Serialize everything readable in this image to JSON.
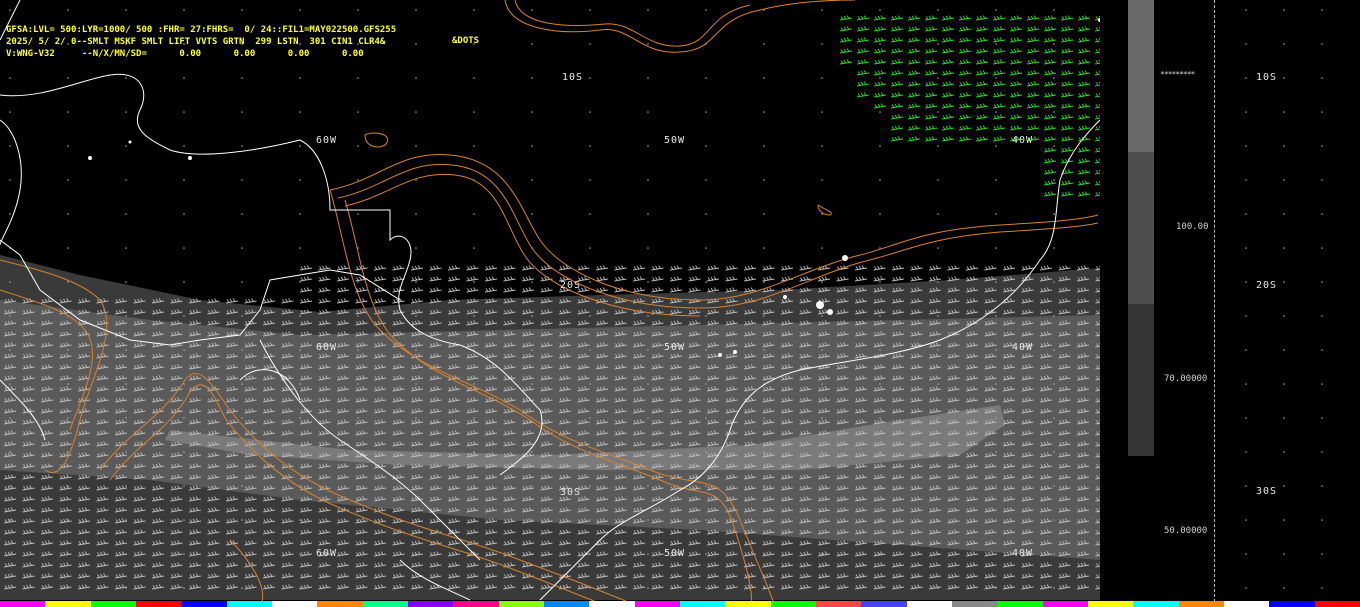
{
  "header": {
    "line1": "GFSA:LVL= 500:LYR=1000/ 500 :FHR= 27:FHRS=  0/ 24::FIL1=MAY022500.GFS255",
    "line2": "2025/ 5/ 2/ 0--SMLT MSKF SMLT LIFT VVTS GRTN  299 LSTN  301 CIN1 CLR4&",
    "line3": "V:WNG-V32     --N/X/MN/SD=      0.00      0.00      0.00      0.00",
    "dots_label": "&DOTS"
  },
  "map_labels": {
    "lat_10s": "10S",
    "lat_20s": "20S",
    "lat_30s": "30S",
    "lon_60w": "60W",
    "lon_50w": "50W",
    "lon_40w": "40W"
  },
  "legend": {
    "values": [
      "100.00",
      "70.00000",
      "50.00000"
    ],
    "stars": "*********"
  },
  "right_labels": [
    "10S",
    "20S",
    "30S"
  ],
  "colors": {
    "header_text": "#ffff33",
    "contour": "#d9822b",
    "wind_green": "#22dd22",
    "wind_gray": "#bdbdbd",
    "coast": "#ffffff",
    "shade_dark": "#3a3a3a",
    "shade_mid": "#595959",
    "shade_light": "#7a7a7a"
  },
  "colorstrip": [
    "#ff00ff",
    "#ffff00",
    "#00ff00",
    "#ff0000",
    "#0000ff",
    "#00ffff",
    "#ffffff",
    "#ff8800",
    "#00ff88",
    "#8800ff",
    "#ff0088",
    "#88ff00",
    "#0088ff",
    "#ffffff",
    "#ff00ff",
    "#00ffff",
    "#ffff00",
    "#00ff00",
    "#ff4444",
    "#4444ff",
    "#ffffff",
    "#888888",
    "#00ff00",
    "#ff00ff",
    "#ffff00",
    "#00ffff",
    "#ff8800",
    "#ffffff",
    "#0000ff",
    "#ff0000"
  ]
}
